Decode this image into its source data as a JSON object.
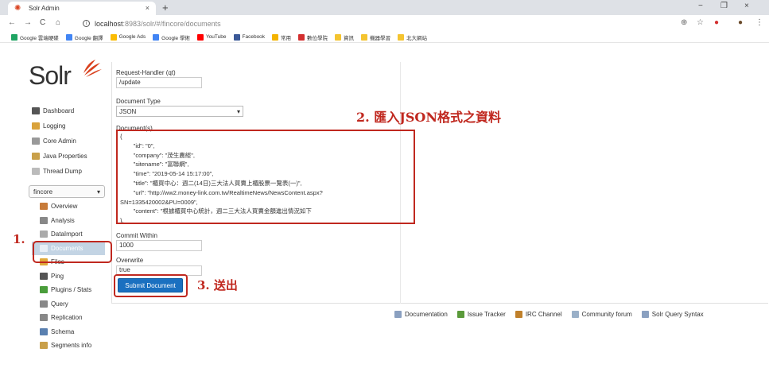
{
  "browser": {
    "tab_title": "Solr Admin",
    "tab_close": "×",
    "new_tab": "+",
    "window_controls": [
      "−",
      "❐",
      "×"
    ],
    "url_host": "localhost",
    "url_rest": ":8983/solr/#/fincore/documents",
    "bookmarks": [
      {
        "label": "Google 雲端硬碟",
        "color": "#1fa463"
      },
      {
        "label": "Google 翻譯",
        "color": "#4285f4"
      },
      {
        "label": "Google Ads",
        "color": "#fbbc04"
      },
      {
        "label": "Google 學術",
        "color": "#4285f4"
      },
      {
        "label": "YouTube",
        "color": "#ff0000"
      },
      {
        "label": "Facebook",
        "color": "#3b5998"
      },
      {
        "label": "常用",
        "color": "#f4b400"
      },
      {
        "label": "數位學院",
        "color": "#d32f2f"
      },
      {
        "label": "資訊",
        "color": "#f4c430"
      },
      {
        "label": "機器學習",
        "color": "#f4c430"
      },
      {
        "label": "北大網站",
        "color": "#f4c430"
      }
    ]
  },
  "logo": {
    "text": "Solr"
  },
  "sidebar": {
    "items": [
      {
        "label": "Dashboard",
        "icon": "dashboard-icon",
        "color": "#555"
      },
      {
        "label": "Logging",
        "icon": "logging-icon",
        "color": "#d9a23b"
      },
      {
        "label": "Core Admin",
        "icon": "core-admin-icon",
        "color": "#999"
      },
      {
        "label": "Java Properties",
        "icon": "java-icon",
        "color": "#c9a04a"
      },
      {
        "label": "Thread Dump",
        "icon": "thread-dump-icon",
        "color": "#bbb"
      }
    ],
    "core_selector": "fincore",
    "core_menu": [
      {
        "label": "Overview",
        "icon": "home-icon",
        "color": "#c77b3a"
      },
      {
        "label": "Analysis",
        "icon": "analysis-icon",
        "color": "#888"
      },
      {
        "label": "DataImport",
        "icon": "dataimport-icon",
        "color": "#aaa"
      },
      {
        "label": "Documents",
        "icon": "documents-icon",
        "color": "#fff",
        "active": true
      },
      {
        "label": "Files",
        "icon": "files-icon",
        "color": "#e0a93a"
      },
      {
        "label": "Ping",
        "icon": "ping-icon",
        "color": "#555"
      },
      {
        "label": "Plugins / Stats",
        "icon": "plugins-icon",
        "color": "#4a9d3b"
      },
      {
        "label": "Query",
        "icon": "query-icon",
        "color": "#888"
      },
      {
        "label": "Replication",
        "icon": "replication-icon",
        "color": "#888"
      },
      {
        "label": "Schema",
        "icon": "schema-icon",
        "color": "#5a80b0"
      },
      {
        "label": "Segments info",
        "icon": "segments-icon",
        "color": "#c9a04a"
      }
    ]
  },
  "form": {
    "handler_label": "Request-Handler (qt)",
    "handler_value": "/update",
    "doctype_label": "Document Type",
    "doctype_value": "JSON",
    "documents_label": "Document(s)",
    "documents_value": "{\n        \"id\": \"0\",\n        \"company\": \"茂生農經\",\n        \"sitename\": \"富聯網\",\n        \"time\": \"2019-05-14 15:17:00\",\n        \"title\": \"櫃買中心：週二(14日)三大法人買賣上櫃股票一覽表(一)\",\n        \"url\": \"http://ww2.money-link.com.tw/RealtimeNews/NewsContent.aspx?\nSN=1335420002&PU=0009\",\n        \"content\": \"根據櫃買中心統計，週二三大法人買賣金額進出情況如下\n},",
    "commit_label": "Commit Within",
    "commit_value": "1000",
    "overwrite_label": "Overwrite",
    "overwrite_value": "true",
    "submit_label": "Submit Document"
  },
  "annotations": {
    "step1": "1.",
    "step2": "2.  匯入JSON格式之資料",
    "step3": "3. 送出"
  },
  "footer": [
    {
      "label": "Documentation",
      "icon": "documentation-icon",
      "color": "#8aa0c0"
    },
    {
      "label": "Issue Tracker",
      "icon": "issue-tracker-icon",
      "color": "#5a9a3a"
    },
    {
      "label": "IRC Channel",
      "icon": "irc-icon",
      "color": "#c0802a"
    },
    {
      "label": "Community forum",
      "icon": "forum-icon",
      "color": "#9ab0c8"
    },
    {
      "label": "Solr Query Syntax",
      "icon": "query-syntax-icon",
      "color": "#8aa0c0"
    }
  ]
}
